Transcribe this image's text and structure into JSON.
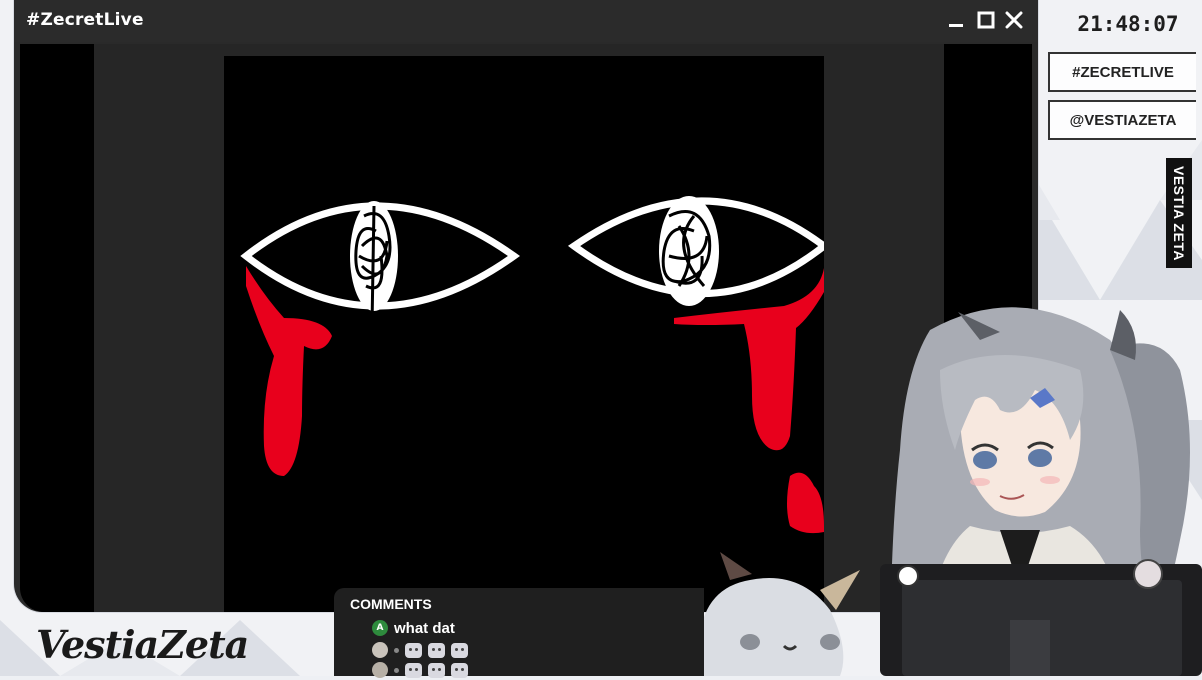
{
  "window": {
    "title": "#ZecretLive"
  },
  "sidebar": {
    "clock": "21:48:07",
    "hashtag": "#ZECRETLIVE",
    "handle": "@VESTIAZETA",
    "vertical_name": "VESTIA ZETA"
  },
  "logo": {
    "text": "VestiaZeta"
  },
  "comments": {
    "header": "COMMENTS",
    "items": [
      {
        "avatar_letter": "A",
        "avatar_color": "#2e8b3d",
        "text": "what dat"
      },
      {
        "avatar_letter": "",
        "avatar_color": "#c9c3bb",
        "text": "",
        "emotes": 3
      },
      {
        "avatar_letter": "",
        "avatar_color": "#b7b0a6",
        "text": "",
        "emotes": 3
      }
    ]
  },
  "colors": {
    "accent_red": "#e8001c",
    "window_dark": "#2b2b2b"
  },
  "icons": [
    "minimize-icon",
    "maximize-icon",
    "close-icon"
  ]
}
